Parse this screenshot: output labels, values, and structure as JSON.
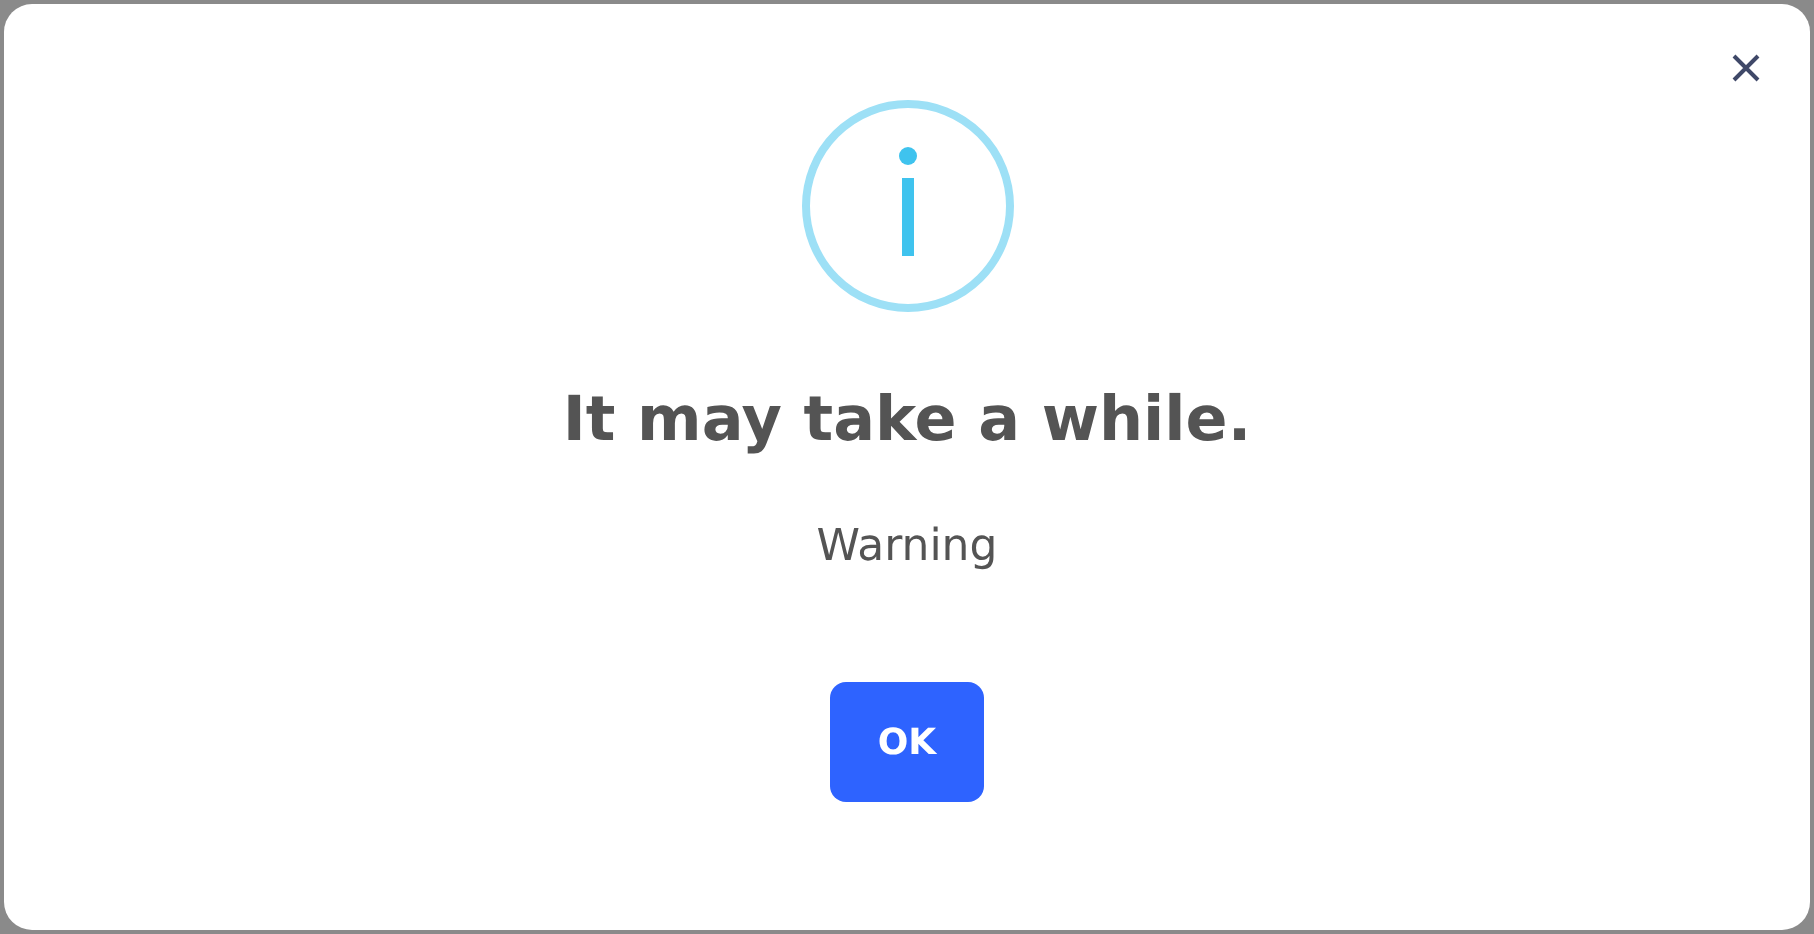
{
  "dialog": {
    "title": "It may take a while.",
    "message": "Warning",
    "buttons": [
      "OK"
    ]
  }
}
